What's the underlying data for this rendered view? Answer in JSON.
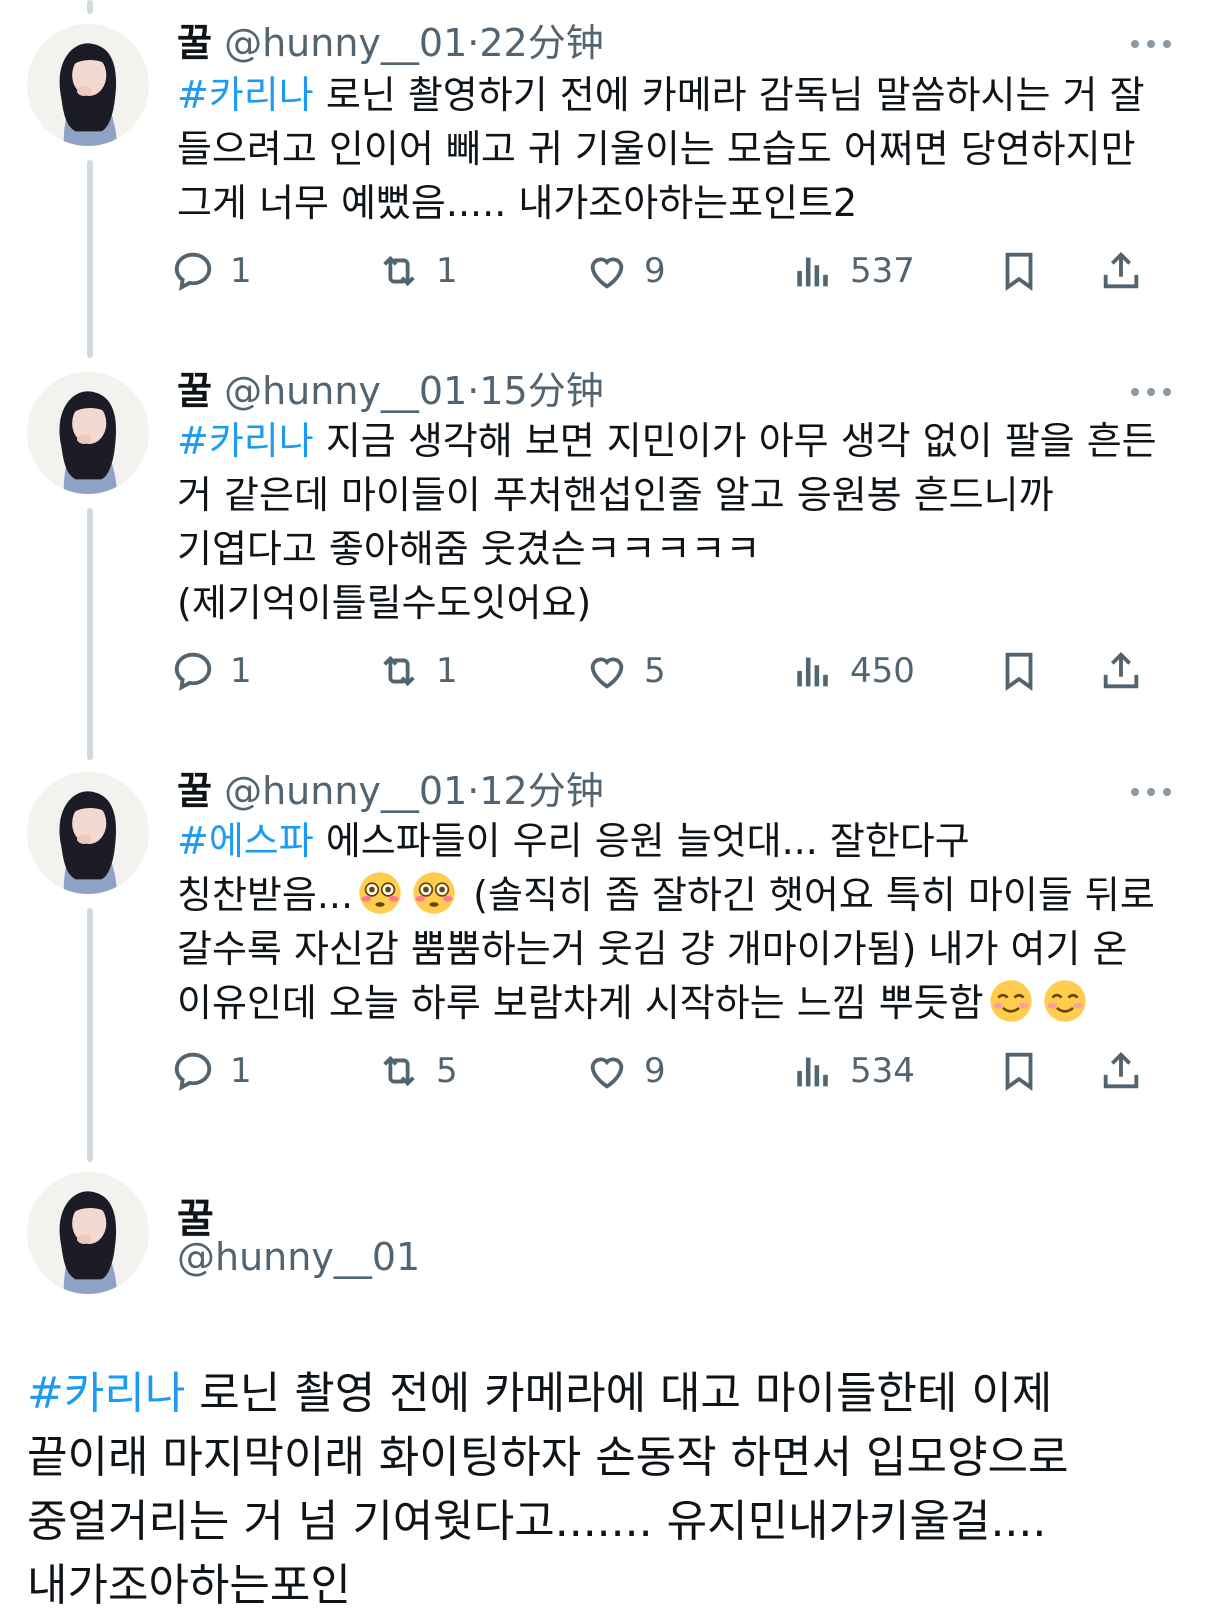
{
  "colors": {
    "hashtag": "#1d9bf0",
    "muted": "#536471",
    "text": "#0f1419",
    "thread_line": "#cfd9de"
  },
  "tweets": [
    {
      "name": "꿀",
      "handle": "@hunny__01",
      "sep": "·",
      "time": "22分钟",
      "hashtag": "#카리나",
      "text": " 로닌 촬영하기 전에 카메라 감독님 말씀하시는 거 잘 들으려고 인이어 빼고 귀 기울이는 모습도 어쩌면 당연하지만 그게 너무 예뻤음..... 내가조아하는포인트2",
      "replies": "1",
      "retweets": "1",
      "likes": "9",
      "views": "537"
    },
    {
      "name": "꿀",
      "handle": "@hunny__01",
      "sep": "·",
      "time": "15分钟",
      "hashtag": "#카리나",
      "text": " 지금 생각해 보면 지민이가 아무 생각 없이 팔을 흔든 거 같은데 마이들이 푸처핸섭인줄 알고 응원봉 흔드니까 기엽다고 좋아해줌 웃겼슨ㅋㅋㅋㅋㅋ (제기억이틀릴수도잇어요)",
      "replies": "1",
      "retweets": "1",
      "likes": "5",
      "views": "450"
    },
    {
      "name": "꿀",
      "handle": "@hunny__01",
      "sep": "·",
      "time": "12分钟",
      "hashtag": "#에스파",
      "text_a": " 에스파들이 우리 응원 늘엇대... 잘한다구 칭찬받음...",
      "text_b": " (솔직히 좀 잘하긴 햇어요 특히 마이들 뒤로 갈수록 자신감 뿜뿜하는거 웃김 걍 개마이가됨) 내가 여기 온 이유인데 오늘 하루 보람차게 시작하는 느낌 뿌듯함",
      "emoji_a": "flushed-face-emoji",
      "emoji_b": "smiling-face-emoji",
      "replies": "1",
      "retweets": "5",
      "likes": "9",
      "views": "534"
    }
  ],
  "main_tweet": {
    "name": "꿀",
    "handle": "@hunny__01",
    "hashtag": "#카리나",
    "text": " 로닌 촬영 전에 카메라에 대고 마이들한테 이제 끝이래 마지막이래 화이팅하자 손동작 하면서 입모양으로 중얼거리는 거 넘 기여웟다고....... 유지민내가키울걸.... 내가조아하는포인"
  },
  "icons": [
    "reply-icon",
    "retweet-icon",
    "like-icon",
    "views-icon",
    "bookmark-icon",
    "share-icon",
    "more-icon"
  ]
}
